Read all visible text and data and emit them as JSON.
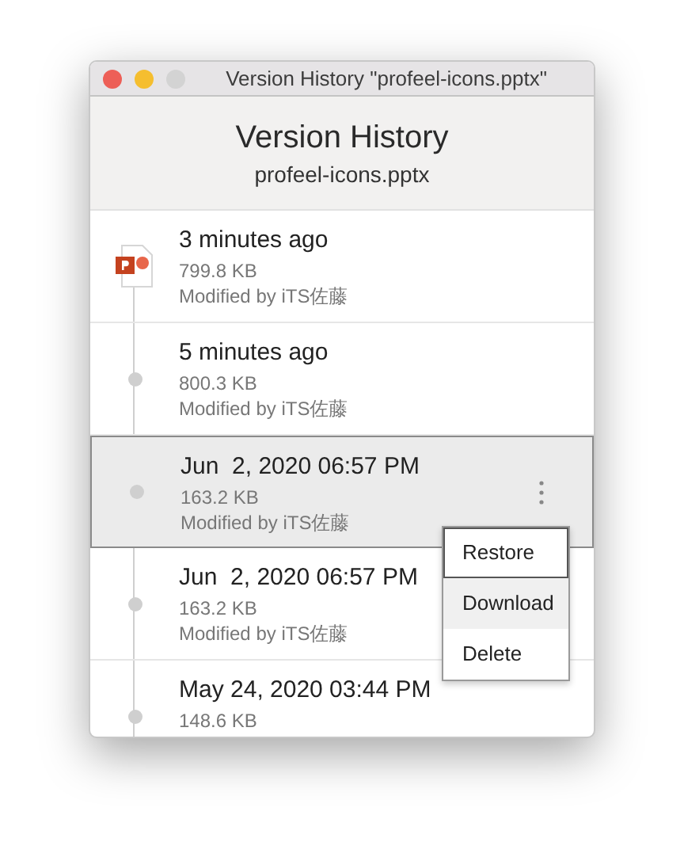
{
  "window": {
    "title": "Version History \"profeel-icons.pptx\""
  },
  "header": {
    "title": "Version History",
    "filename": "profeel-icons.pptx"
  },
  "versions": [
    {
      "kind": "file",
      "time": "3 minutes ago",
      "size": "799.8 KB",
      "author": "Modified by iTS佐藤",
      "selected": false
    },
    {
      "kind": "dot",
      "time": "5 minutes ago",
      "size": "800.3 KB",
      "author": "Modified by iTS佐藤",
      "selected": false
    },
    {
      "kind": "dot",
      "time": "Jun  2, 2020 06:57 PM",
      "size": "163.2 KB",
      "author": "Modified by iTS佐藤",
      "selected": true
    },
    {
      "kind": "dot",
      "time": "Jun  2, 2020 06:57 PM",
      "size": "163.2 KB",
      "author": "Modified by iTS佐藤",
      "selected": false
    },
    {
      "kind": "dot",
      "time": "May 24, 2020 03:44 PM",
      "size": "148.6 KB",
      "selected": false
    }
  ],
  "context_menu": [
    {
      "label": "Restore",
      "focused": true,
      "highlighted": false
    },
    {
      "label": "Download",
      "focused": false,
      "highlighted": true
    },
    {
      "label": "Delete",
      "focused": false,
      "highlighted": false
    }
  ]
}
